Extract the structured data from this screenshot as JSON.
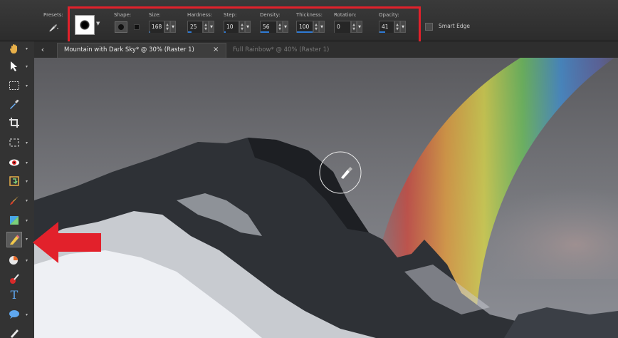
{
  "options_bar": {
    "presets_label": "Presets:",
    "shape_label": "Shape:",
    "size": {
      "label": "Size:",
      "value": "168",
      "fill_percent": 5
    },
    "hardness": {
      "label": "Hardness:",
      "value": "25",
      "fill_percent": 25
    },
    "step": {
      "label": "Step:",
      "value": "10",
      "fill_percent": 10
    },
    "density": {
      "label": "Density:",
      "value": "56",
      "fill_percent": 56
    },
    "thickness": {
      "label": "Thickness:",
      "value": "100",
      "fill_percent": 100
    },
    "rotation": {
      "label": "Rotation:",
      "value": "0",
      "fill_percent": 0
    },
    "opacity": {
      "label": "Opacity:",
      "value": "41",
      "fill_percent": 41
    },
    "smart_edge_label": "Smart Edge",
    "spin_up": "▲",
    "spin_down": "▼",
    "drop_caret": "▼"
  },
  "tabs": {
    "back_glyph": "‹",
    "active_label": "Mountain with Dark Sky* @  30% (Raster 1)",
    "close_glyph": "×",
    "inactive_label": "Full Rainbow* @  40% (Raster 1)"
  },
  "toolbar": {
    "text_tool_glyph": "T",
    "caret_glyph": "▾"
  },
  "colors": {
    "highlight": "#e2212b",
    "accent": "#2f7bd6"
  }
}
